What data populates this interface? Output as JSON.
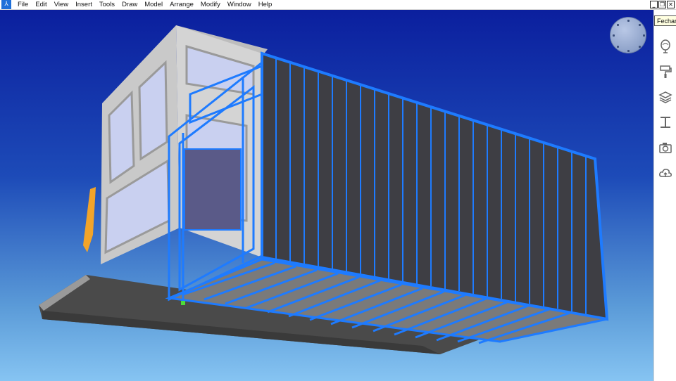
{
  "menu": {
    "items": [
      "File",
      "Edit",
      "View",
      "Insert",
      "Tools",
      "Draw",
      "Model",
      "Arrange",
      "Modify",
      "Window",
      "Help"
    ]
  },
  "window_controls": {
    "minimize": "_",
    "restore": "❐",
    "close": "✕"
  },
  "tooltip": {
    "text": "Fechar"
  },
  "toolbar": {
    "icons": [
      "move-icon",
      "balloon-icon",
      "paint-roller-icon",
      "layers-icon",
      "beam-icon",
      "camera-icon",
      "cloud-upload-icon"
    ]
  },
  "colors": {
    "viewport_top": "#0b1f9e",
    "viewport_bottom": "#86c4f2",
    "selection_blue": "#1e7bff",
    "floor_dark": "#4a4a4a",
    "cabin_gray": "#c8c8c8"
  }
}
